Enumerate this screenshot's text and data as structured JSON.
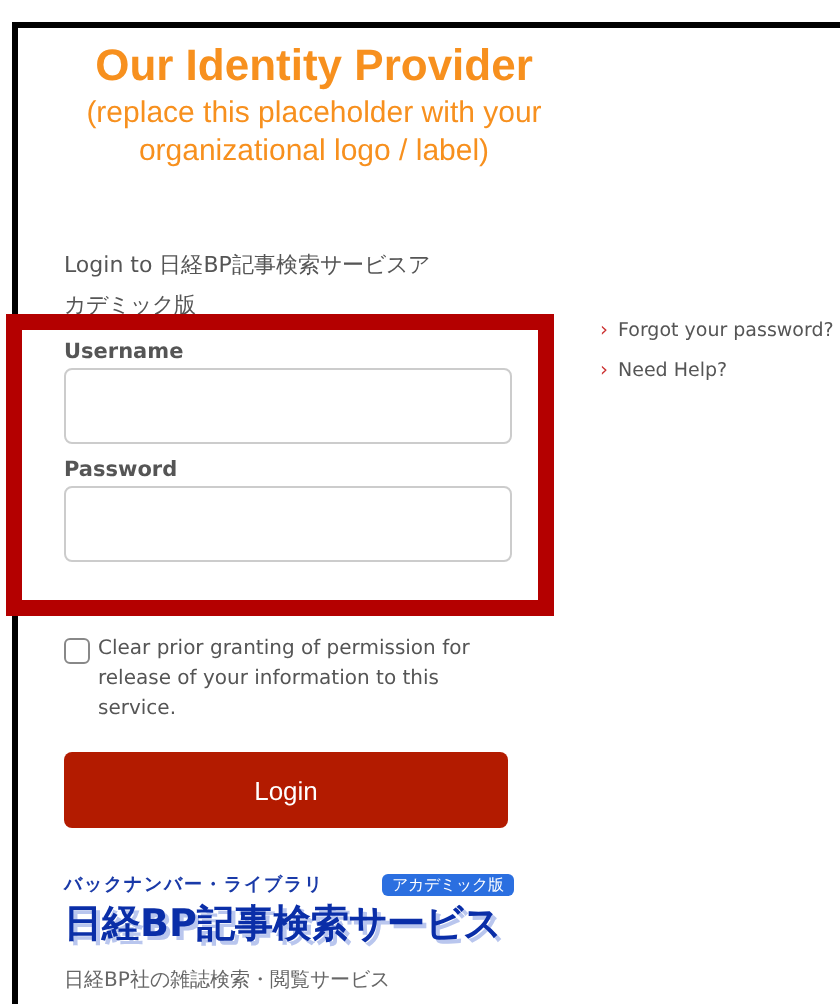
{
  "header": {
    "title": "Our Identity Provider",
    "subtitle": "(replace this placeholder with your organizational logo / label)"
  },
  "intro": "Login to 日経BP記事検索サービスアカデミック版",
  "fields": [
    {
      "label": "Username"
    },
    {
      "label": "Password"
    }
  ],
  "checkboxes": [
    {
      "label": "Clear prior granting of permission for release of your information to this service.",
      "checked": false
    }
  ],
  "login_button": "Login",
  "links": [
    {
      "marker": "›",
      "text": "Forgot your password?"
    },
    {
      "marker": "›",
      "text": "Need Help?"
    }
  ],
  "service_logo": {
    "tagline": "バックナンバー・ライブラリ",
    "badge": "アカデミック版",
    "name": "日経BP記事検索サービス"
  },
  "caption": "日経BP社の雑誌検索・閲覧サービス"
}
